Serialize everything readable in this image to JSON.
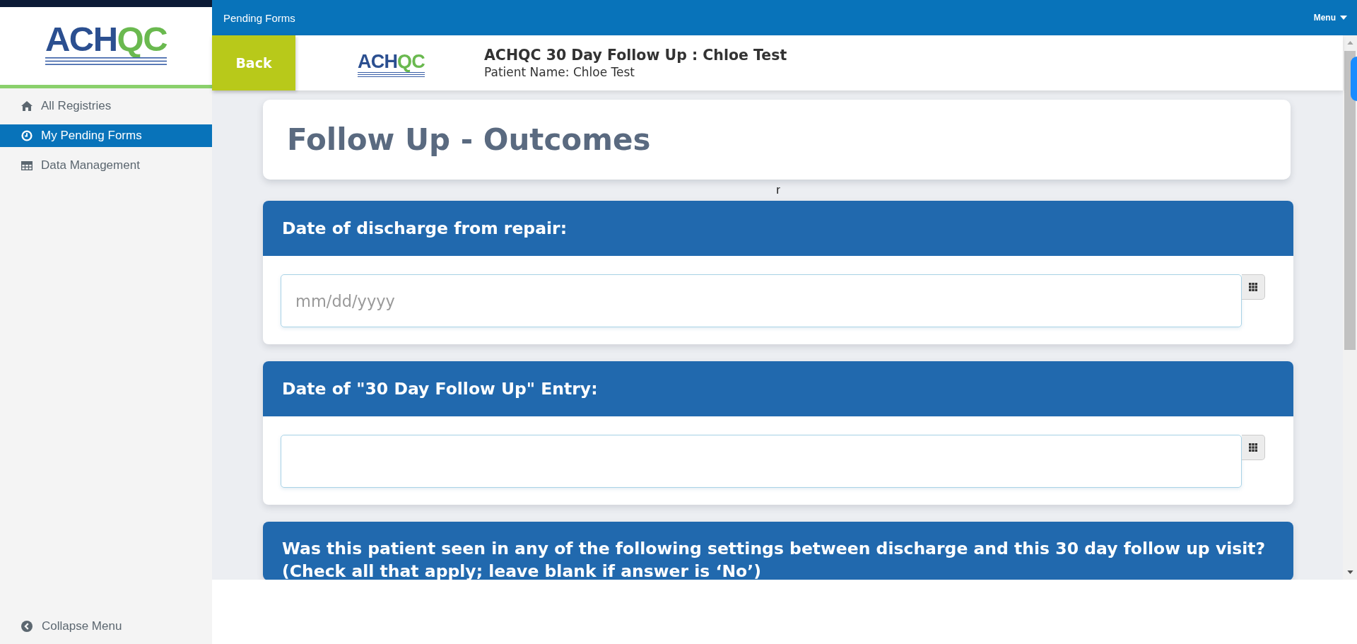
{
  "top_bar": {
    "title": "Pending Forms",
    "menu": "Menu"
  },
  "sidebar": {
    "logo": [
      {
        "text": "ACH",
        "color": "#2b4f90"
      },
      {
        "text": "QC",
        "color": "#6ab94f"
      }
    ],
    "items": [
      {
        "label": "All Registries",
        "selected": false
      },
      {
        "label": "My Pending Forms",
        "selected": true
      },
      {
        "label": "Data Management",
        "selected": false
      }
    ],
    "collapse": "Collapse Menu"
  },
  "header": {
    "back": "Back",
    "logo": [
      {
        "text": "ACH",
        "color": "#2b4f90"
      },
      {
        "text": "QC",
        "color": "#6ab94f"
      }
    ],
    "title": "ACHQC 30 Day Follow Up : Chloe Test",
    "subtitle": "Patient Name: Chloe Test"
  },
  "form": {
    "title": "Follow Up - Outcomes",
    "stray_text": "r",
    "questions": [
      {
        "kind": "date",
        "label": "Date of discharge from repair:",
        "placeholder": "mm/dd/yyyy"
      },
      {
        "kind": "date",
        "label": "Date of \"30 Day Follow Up\" Entry:"
      },
      {
        "kind": "checklist",
        "label": "Was this patient seen in any of the following settings between discharge and this 30 day follow up visit?",
        "note": "(Check all that apply; leave blank if answer is ‘No’)"
      }
    ]
  }
}
